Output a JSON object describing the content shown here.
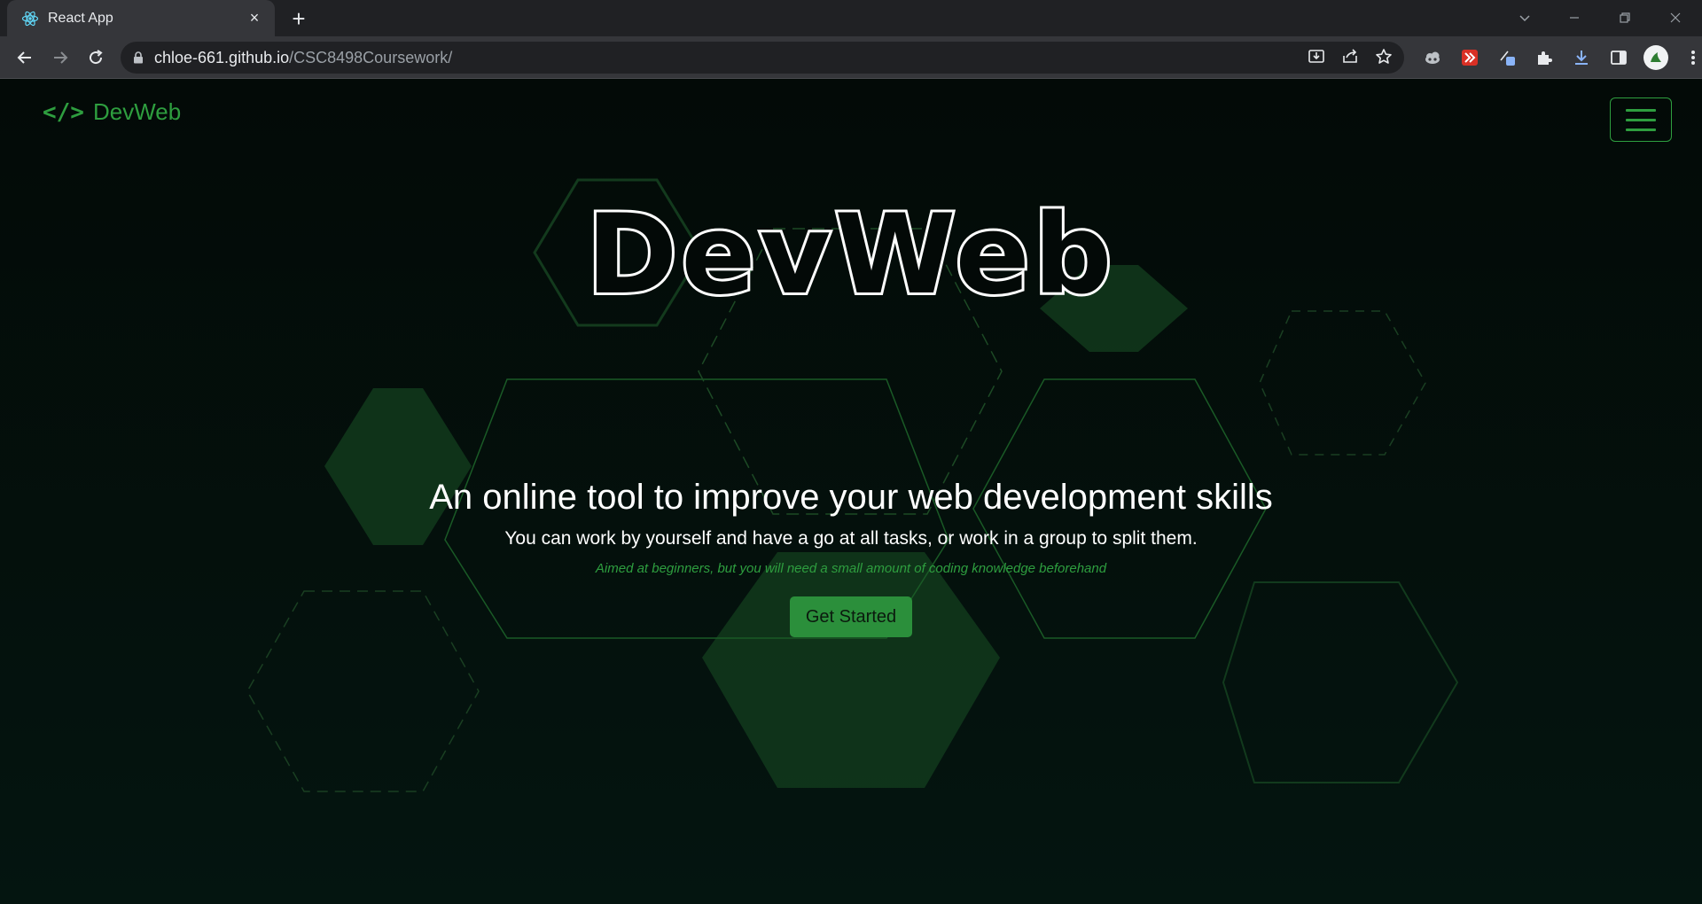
{
  "browser": {
    "tab_title": "React App",
    "tab_close": "×",
    "new_tab": "+",
    "url_host": "chloe-661.github.io",
    "url_path": "/CSC8498Coursework/"
  },
  "navbar": {
    "brand_icon": "</>",
    "brand_name": "DevWeb"
  },
  "hero": {
    "title": "DevWeb",
    "tagline": "An online tool to improve your web development skills",
    "subtitle": "You can work by yourself and have a go at all tasks, or work in a group to split them.",
    "note": "Aimed at beginners, but you will need a small amount of coding knowledge beforehand",
    "cta_label": "Get Started"
  },
  "colors": {
    "accent": "#2e9e3f",
    "background": "#030907",
    "hex_fill": "#123a1c"
  }
}
